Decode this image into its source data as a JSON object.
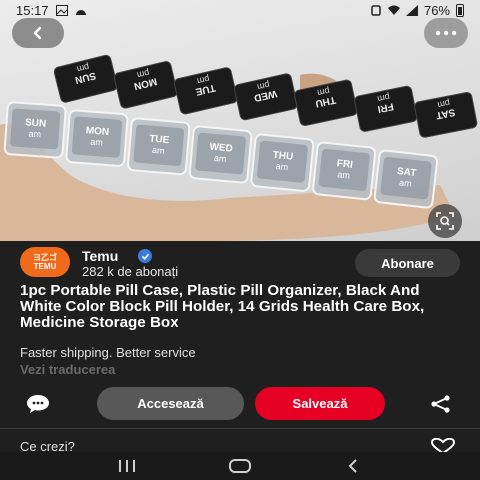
{
  "status_bar": {
    "time": "15:17",
    "battery": "76%"
  },
  "hero": {
    "image_alt": "pill organizer",
    "days_lid": [
      "SUN",
      "MON",
      "TUE",
      "WED",
      "THU",
      "FRI",
      "SAT"
    ],
    "period_lid": "pm",
    "days_box": [
      "SUN",
      "MON",
      "TUE",
      "WED",
      "THU",
      "FRI",
      "SAT"
    ],
    "period_box": "am"
  },
  "seller": {
    "avatar_top": "ヨ乙ゴ",
    "avatar_bottom": "TEMU",
    "name": "Temu",
    "followers": "282 k de abonați",
    "follow_label": "Abonare"
  },
  "pin": {
    "title": "1pc Portable Pill Case, Plastic Pill Organizer, Black And White Color Block Pill Holder, 14 Grids Health Care Box, Medicine Storage Box",
    "description": "Faster shipping. Better service",
    "translate_label": "Vezi traducerea"
  },
  "actions": {
    "access_label": "Accesează",
    "save_label": "Salvează"
  },
  "comments": {
    "prompt": "Ce crezi?"
  },
  "colors": {
    "save": "#e60023",
    "access": "#585858",
    "background": "#1f1f1f",
    "brand": "#f16a1b"
  }
}
